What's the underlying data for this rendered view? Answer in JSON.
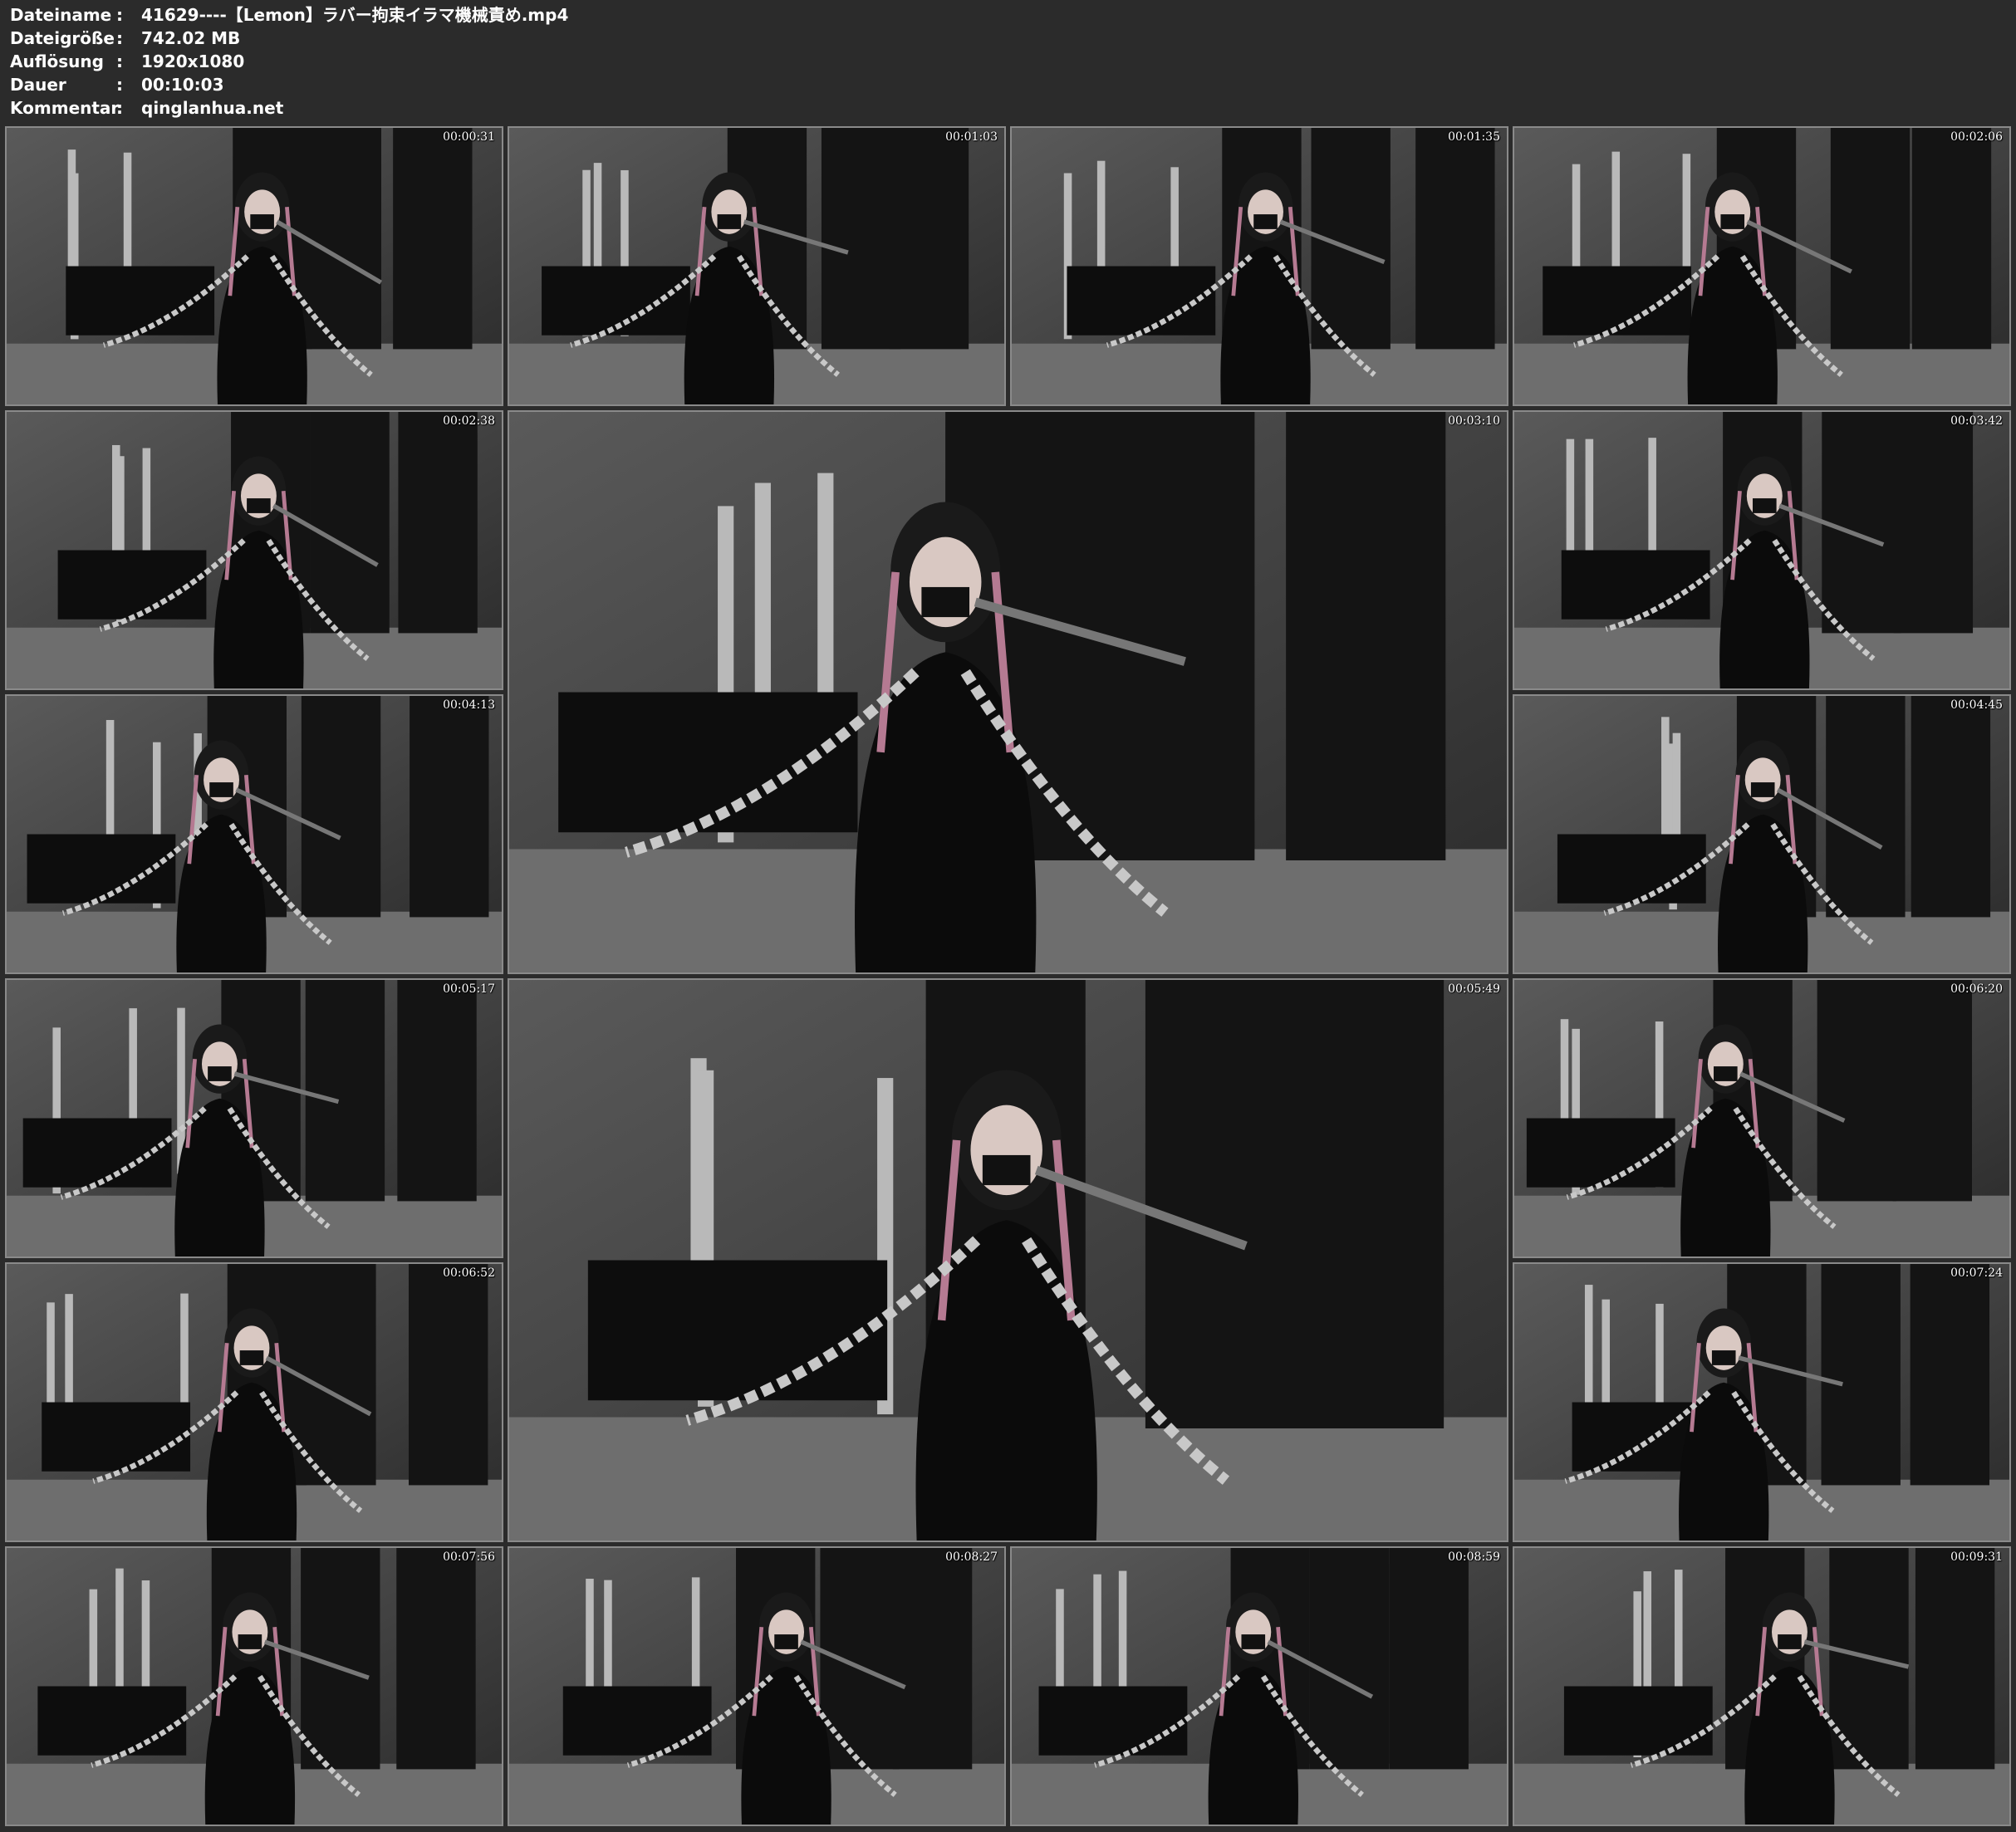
{
  "info": [
    {
      "label": "Dateiname",
      "sep": ":",
      "value": "41629----【Lemon】ラバー拘束イラマ機械責め.mp4"
    },
    {
      "label": "Dateigröße",
      "sep": ":",
      "value": "742.02 MB"
    },
    {
      "label": "Auflösung",
      "sep": ":",
      "value": "1920x1080"
    },
    {
      "label": "Dauer",
      "sep": ":",
      "value": "00:10:03"
    },
    {
      "label": "Kommentar",
      "sep": ":",
      "value": "qinglanhua.net"
    }
  ],
  "thumbnails": [
    {
      "timestamp": "00:00:31"
    },
    {
      "timestamp": "00:01:03"
    },
    {
      "timestamp": "00:01:35"
    },
    {
      "timestamp": "00:02:06"
    },
    {
      "timestamp": "00:02:38"
    },
    {
      "timestamp": "00:03:10"
    },
    {
      "timestamp": "00:03:42"
    },
    {
      "timestamp": "00:04:13"
    },
    {
      "timestamp": "00:04:45"
    },
    {
      "timestamp": "00:05:17"
    },
    {
      "timestamp": "00:05:49"
    },
    {
      "timestamp": "00:06:20"
    },
    {
      "timestamp": "00:06:52"
    },
    {
      "timestamp": "00:07:24"
    },
    {
      "timestamp": "00:07:56"
    },
    {
      "timestamp": "00:08:27"
    },
    {
      "timestamp": "00:08:59"
    },
    {
      "timestamp": "00:09:31"
    }
  ]
}
